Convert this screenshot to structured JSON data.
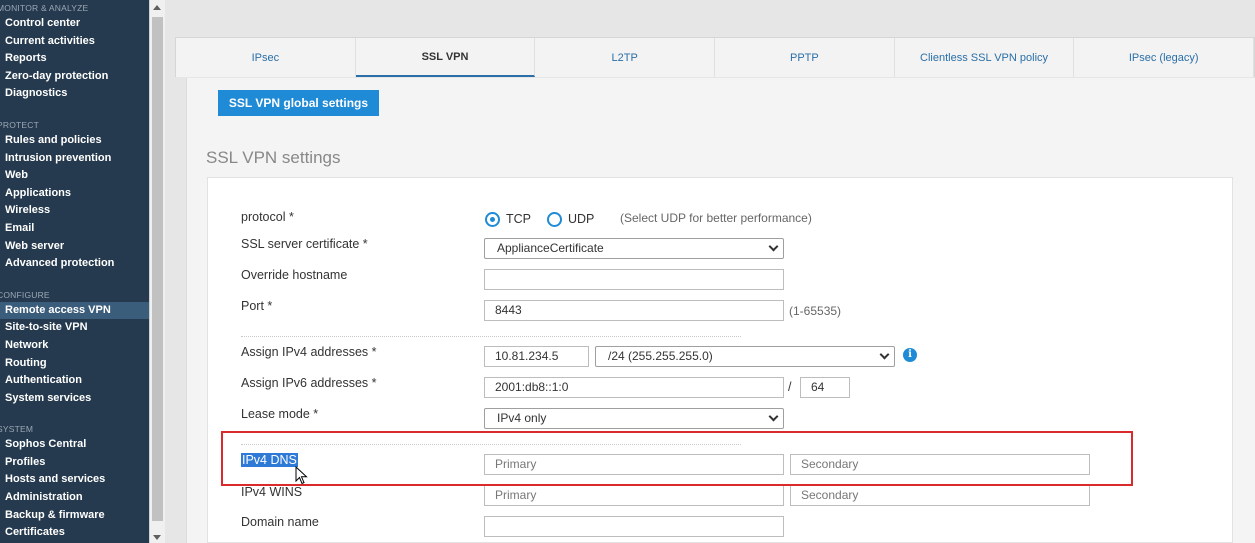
{
  "sidebar": {
    "sections": [
      {
        "title": "MONITOR & ANALYZE",
        "items": [
          "Control center",
          "Current activities",
          "Reports",
          "Zero-day protection",
          "Diagnostics"
        ]
      },
      {
        "title": "PROTECT",
        "items": [
          "Rules and policies",
          "Intrusion prevention",
          "Web",
          "Applications",
          "Wireless",
          "Email",
          "Web server",
          "Advanced protection"
        ]
      },
      {
        "title": "CONFIGURE",
        "items": [
          "Remote access VPN",
          "Site-to-site VPN",
          "Network",
          "Routing",
          "Authentication",
          "System services"
        ]
      },
      {
        "title": "SYSTEM",
        "items": [
          "Sophos Central",
          "Profiles",
          "Hosts and services",
          "Administration",
          "Backup & firmware",
          "Certificates"
        ]
      }
    ],
    "active_item": "Remote access VPN"
  },
  "tabs": [
    "IPsec",
    "SSL VPN",
    "L2TP",
    "PPTP",
    "Clientless SSL VPN policy",
    "IPsec (legacy)"
  ],
  "active_tab": "SSL VPN",
  "global_button": "SSL VPN global settings",
  "section_title": "SSL VPN settings",
  "form": {
    "protocol": {
      "label": "protocol *",
      "options": [
        "TCP",
        "UDP"
      ],
      "selected": "TCP",
      "hint": "(Select UDP for better performance)"
    },
    "certificate": {
      "label": "SSL server certificate *",
      "value": "ApplianceCertificate"
    },
    "override_hostname": {
      "label": "Override hostname",
      "value": ""
    },
    "port": {
      "label": "Port *",
      "value": "8443",
      "hint": "(1-65535)"
    },
    "ipv4_assign": {
      "label": "Assign IPv4 addresses *",
      "address": "10.81.234.5",
      "mask": "/24 (255.255.255.0)"
    },
    "ipv6_assign": {
      "label": "Assign IPv6 addresses *",
      "address": "2001:db8::1:0",
      "separator": "/",
      "prefix": "64"
    },
    "lease_mode": {
      "label": "Lease mode *",
      "value": "IPv4 only"
    },
    "ipv4_dns": {
      "label": "IPv4 DNS",
      "primary_placeholder": "Primary",
      "secondary_placeholder": "Secondary"
    },
    "ipv4_wins": {
      "label": "IPv4 WINS",
      "primary_placeholder": "Primary",
      "secondary_placeholder": "Secondary"
    },
    "domain_name": {
      "label": "Domain name",
      "value": ""
    }
  },
  "colors": {
    "accent": "#1f8ad6",
    "sidebar_bg": "#253a4e",
    "highlight_border": "#d92b2b"
  }
}
